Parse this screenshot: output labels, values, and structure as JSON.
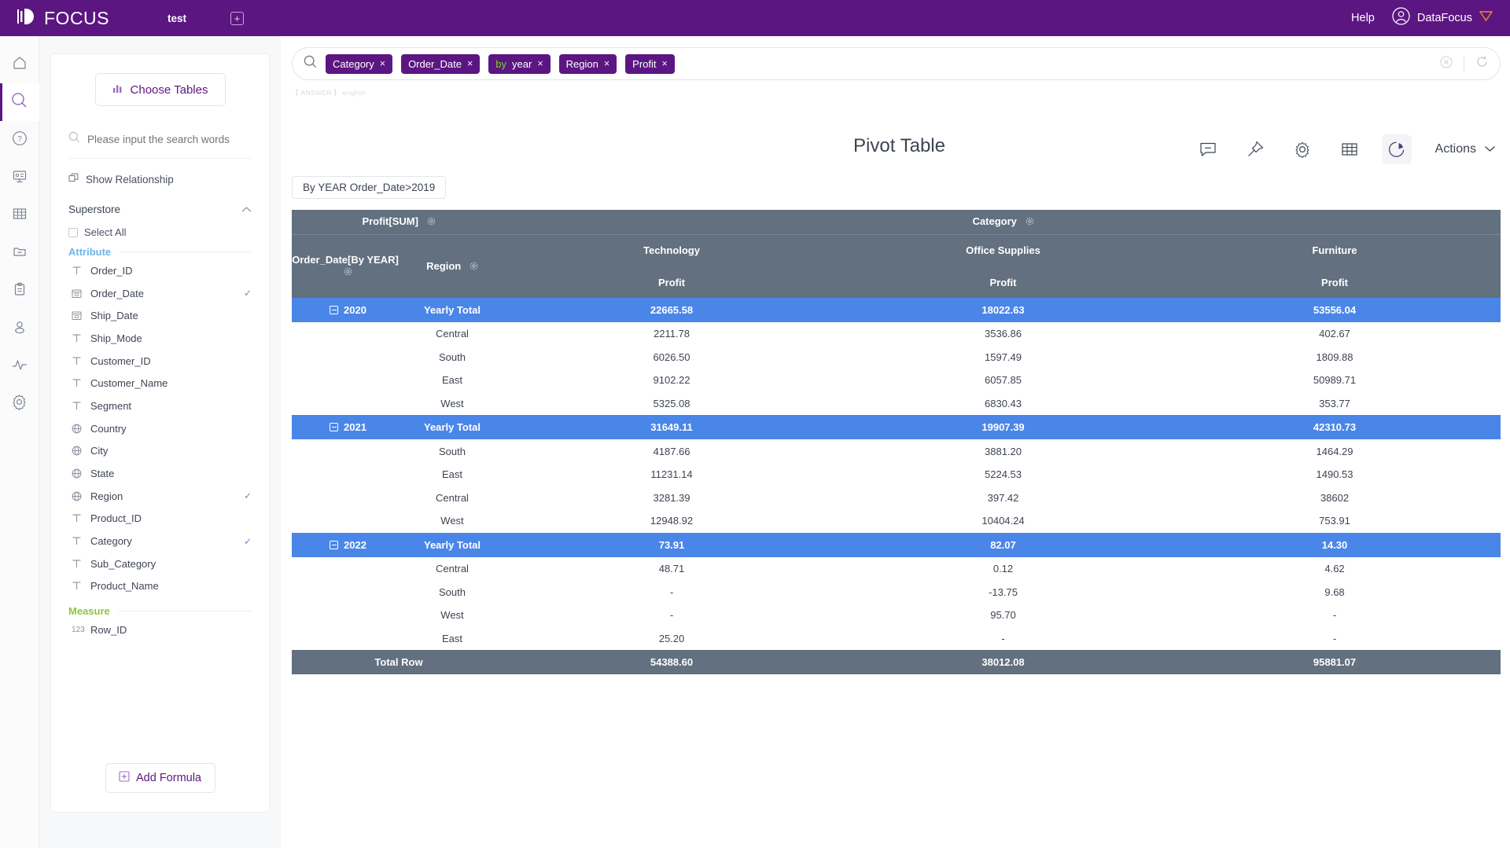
{
  "topbar": {
    "logo_text": "FOCUS",
    "tab_label": "test",
    "add_tab_label": "+",
    "help_label": "Help",
    "user_name": "DataFocus",
    "brand_color": "#5c1682"
  },
  "rail": {
    "items": [
      {
        "name": "home-icon",
        "active": false
      },
      {
        "name": "search-icon",
        "active": true
      },
      {
        "name": "help-circle-icon",
        "active": false
      },
      {
        "name": "presentation-icon",
        "active": false
      },
      {
        "name": "table-grid-icon",
        "active": false
      },
      {
        "name": "folder-minus-icon",
        "active": false
      },
      {
        "name": "clipboard-icon",
        "active": false
      },
      {
        "name": "user-icon",
        "active": false
      },
      {
        "name": "activity-icon",
        "active": false
      },
      {
        "name": "gear-icon",
        "active": false
      }
    ]
  },
  "sidebar": {
    "choose_tables_label": "Choose Tables",
    "search_placeholder": "Please input the search words",
    "search_value": "",
    "show_relationship_label": "Show Relationship",
    "table_name": "Superstore",
    "select_all_label": "Select All",
    "attribute_label": "Attribute",
    "measure_label": "Measure",
    "add_formula_label": "Add Formula",
    "attributes": [
      {
        "label": "Order_ID",
        "type": "text",
        "selected": false
      },
      {
        "label": "Order_Date",
        "type": "date",
        "selected": true
      },
      {
        "label": "Ship_Date",
        "type": "date",
        "selected": false
      },
      {
        "label": "Ship_Mode",
        "type": "text",
        "selected": false
      },
      {
        "label": "Customer_ID",
        "type": "text",
        "selected": false
      },
      {
        "label": "Customer_Name",
        "type": "text",
        "selected": false
      },
      {
        "label": "Segment",
        "type": "text",
        "selected": false
      },
      {
        "label": "Country",
        "type": "geo",
        "selected": false
      },
      {
        "label": "City",
        "type": "geo",
        "selected": false
      },
      {
        "label": "State",
        "type": "geo",
        "selected": false
      },
      {
        "label": "Region",
        "type": "geo",
        "selected": true
      },
      {
        "label": "Product_ID",
        "type": "text",
        "selected": false
      },
      {
        "label": "Category",
        "type": "text",
        "selected": true
      },
      {
        "label": "Sub_Category",
        "type": "text",
        "selected": false
      },
      {
        "label": "Product_Name",
        "type": "text",
        "selected": false
      }
    ],
    "measures": [
      {
        "label": "Row_ID",
        "type": "number",
        "selected": false
      }
    ]
  },
  "search": {
    "tokens": [
      {
        "keyword": "",
        "text": "Category"
      },
      {
        "keyword": "",
        "text": "Order_Date"
      },
      {
        "keyword": "by",
        "text": "year"
      },
      {
        "keyword": "",
        "text": "Region"
      },
      {
        "keyword": "",
        "text": "Profit"
      }
    ],
    "close_label": "×",
    "clear_icon": "clear-circle-icon",
    "refresh_icon": "refresh-icon"
  },
  "answer_tag": "【 ANSWER 】 english",
  "toolbar": {
    "icons": [
      {
        "name": "comment-icon",
        "active": false
      },
      {
        "name": "pin-icon",
        "active": false
      },
      {
        "name": "gear-icon",
        "active": false
      },
      {
        "name": "table-icon",
        "active": false
      },
      {
        "name": "chart-pie-icon",
        "active": true
      }
    ],
    "actions_label": "Actions"
  },
  "chart_title": "Pivot Table",
  "filter_chip": "By YEAR Order_Date>2019",
  "chart_data": {
    "type": "table",
    "title": "Pivot Table",
    "measure_header": "Profit[SUM]",
    "column_dimension_label": "Category",
    "row_dim_1_label": "Order_Date[By YEAR]",
    "row_dim_2_label": "Region",
    "categories": [
      "Technology",
      "Office Supplies",
      "Furniture"
    ],
    "measure_sub_label": "Profit",
    "yearly_total_label": "Yearly Total",
    "total_row_label": "Total Row",
    "groups": [
      {
        "year": "2020",
        "total": [
          "22665.58",
          "18022.63",
          "53556.04"
        ],
        "rows": [
          {
            "region": "Central",
            "values": [
              "2211.78",
              "3536.86",
              "402.67"
            ]
          },
          {
            "region": "South",
            "values": [
              "6026.50",
              "1597.49",
              "1809.88"
            ]
          },
          {
            "region": "East",
            "values": [
              "9102.22",
              "6057.85",
              "50989.71"
            ]
          },
          {
            "region": "West",
            "values": [
              "5325.08",
              "6830.43",
              "353.77"
            ]
          }
        ]
      },
      {
        "year": "2021",
        "total": [
          "31649.11",
          "19907.39",
          "42310.73"
        ],
        "rows": [
          {
            "region": "South",
            "values": [
              "4187.66",
              "3881.20",
              "1464.29"
            ]
          },
          {
            "region": "East",
            "values": [
              "11231.14",
              "5224.53",
              "1490.53"
            ]
          },
          {
            "region": "Central",
            "values": [
              "3281.39",
              "397.42",
              "38602"
            ]
          },
          {
            "region": "West",
            "values": [
              "12948.92",
              "10404.24",
              "753.91"
            ]
          }
        ]
      },
      {
        "year": "2022",
        "total": [
          "73.91",
          "82.07",
          "14.30"
        ],
        "rows": [
          {
            "region": "Central",
            "values": [
              "48.71",
              "0.12",
              "4.62"
            ]
          },
          {
            "region": "South",
            "values": [
              "-",
              "-13.75",
              "9.68"
            ]
          },
          {
            "region": "West",
            "values": [
              "-",
              "95.70",
              "-"
            ]
          },
          {
            "region": "East",
            "values": [
              "25.20",
              "-",
              "-"
            ]
          }
        ]
      }
    ],
    "totals": [
      "54388.60",
      "38012.08",
      "95881.07"
    ],
    "header_bg": "#62707f",
    "group_bg": "#4a86e8",
    "negative_color": "#e8302c"
  }
}
